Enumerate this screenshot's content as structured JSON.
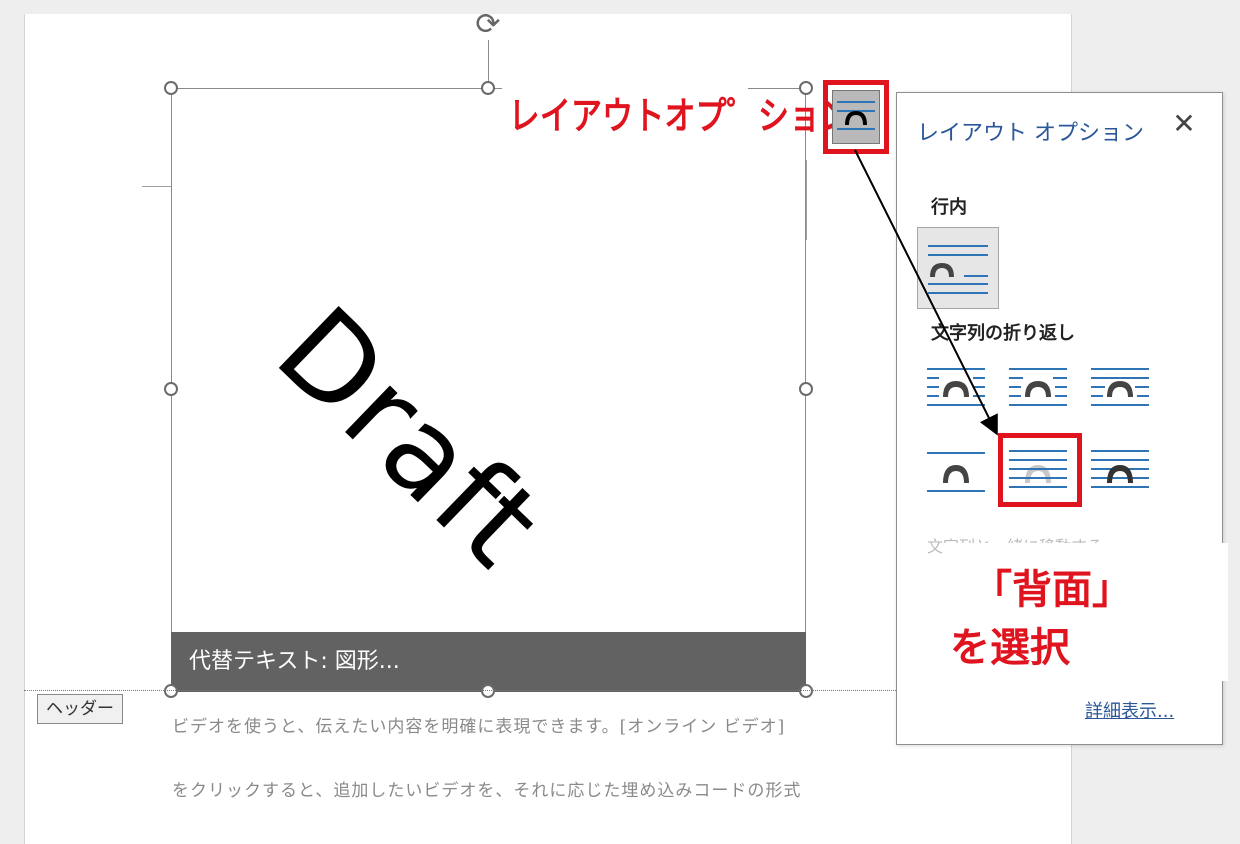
{
  "annotations": {
    "layout_options_label": "レイアウトオプ゜ション",
    "callout_line1": "「背面」",
    "callout_line2": "を選択",
    "highlight_color": "#e0141e"
  },
  "shape": {
    "watermark_text": "Draft",
    "alt_text": "代替テキスト: 図形..."
  },
  "document": {
    "header_tag": "ヘッダー",
    "body_lines": [
      "ビデオを使うと、伝えたい内容を明確に表現できます。[オンライン ビデオ]",
      "をクリックすると、追加したいビデオを、それに応じた埋め込みコードの形式"
    ]
  },
  "panel": {
    "title": "レイアウト オプション",
    "close_icon": "close-icon",
    "section_inline": "行内",
    "section_wrap": "文字列の折り返し",
    "wrap_options": [
      "square",
      "tight",
      "through",
      "top-and-bottom",
      "behind-text",
      "in-front-of-text"
    ],
    "selected_option": "behind-text",
    "faded_option_text": "文字列と一緒に移動する",
    "detail_link": "詳細表示..."
  },
  "colors": {
    "accent_blue": "#2b579a",
    "line_blue": "#2e75b6",
    "alt_bar": "#626262"
  }
}
